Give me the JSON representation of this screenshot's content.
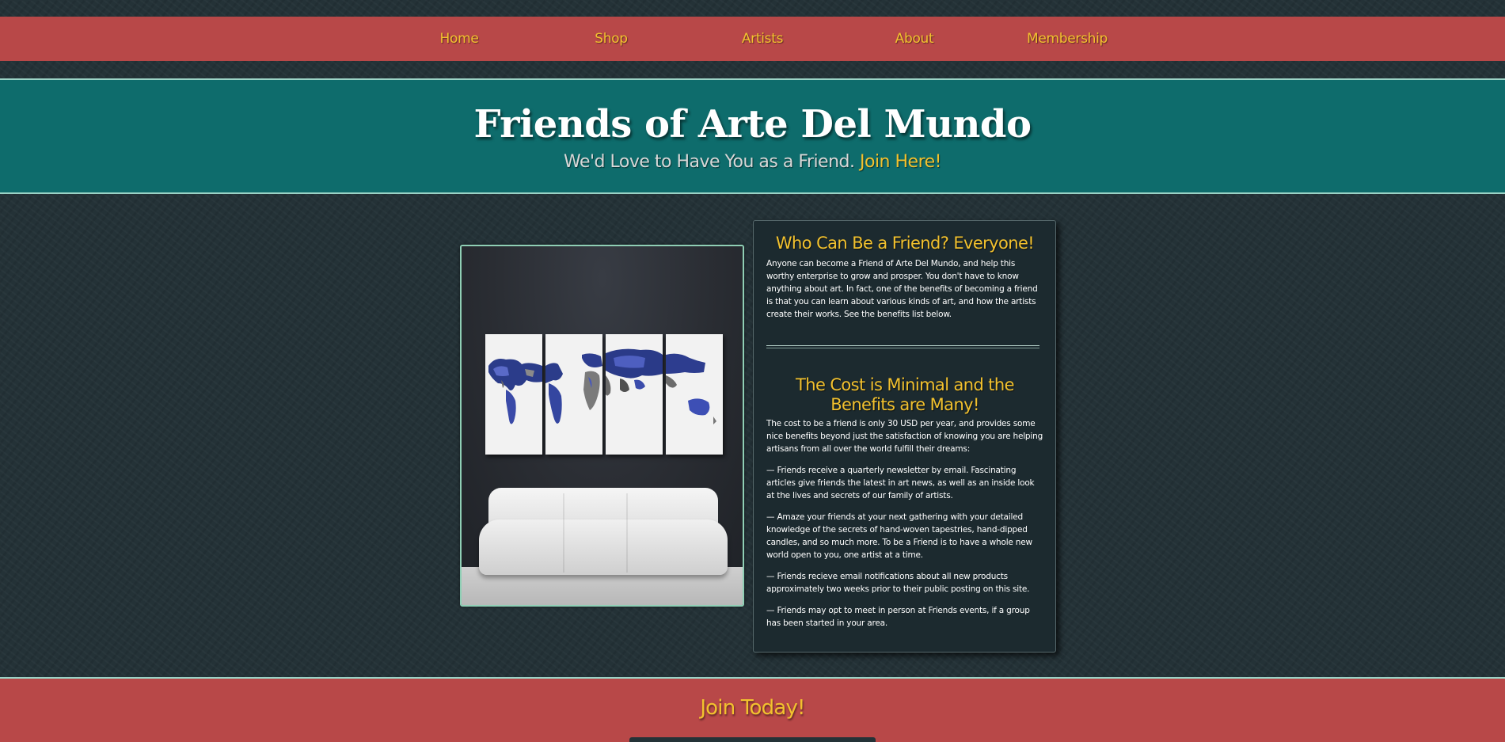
{
  "nav": {
    "items": [
      {
        "label": "Home"
      },
      {
        "label": "Shop"
      },
      {
        "label": "Artists"
      },
      {
        "label": "About"
      },
      {
        "label": "Membership"
      }
    ]
  },
  "hero": {
    "title": "Friends of Arte Del Mundo",
    "subtitle": "We'd Love to Have You as a Friend.",
    "join_link": "Join Here!"
  },
  "image": {
    "subject": "world map canvas above a white sofa"
  },
  "info": {
    "section1_title": "Who Can Be a Friend? Everyone!",
    "section1_body": "Anyone can become a Friend of Arte Del Mundo, and help this worthy enterprise to grow and prosper. You don't have to know anything about art. In fact, one of the benefits of becoming a friend is that you can learn about various kinds of art, and how the artists create their works. See the benefits list below.",
    "section2_title": "The Cost is Minimal and the Benefits are Many!",
    "section2_intro": "The cost to be a friend is only 30 USD per year, and provides some nice benefits beyond just the satisfaction of knowing you are helping artisans from all over the world fulfill their dreams:",
    "benefits": [
      "— Friends receive a quarterly newsletter by email. Fascinating articles give friends the latest in art news, as well as an inside look at the lives and secrets of our family of artists.",
      "— Amaze your friends at your next gathering with your detailed knowledge of the secrets of hand-woven tapestries, hand-dipped candles, and so much more. To be a Friend is to have a whole new world open to you, one artist at a time.",
      "— Friends recieve email notifications about all new products approximately two weeks prior to their public posting on this site.",
      "— Friends may opt to meet in person at Friends events, if a group has been started in your area."
    ]
  },
  "cta": {
    "title": "Join Today!"
  },
  "colors": {
    "nav_bg": "#b84848",
    "accent_gold": "#f2c12e",
    "hero_teal": "#0e6c6c",
    "page_bg": "#243237"
  }
}
